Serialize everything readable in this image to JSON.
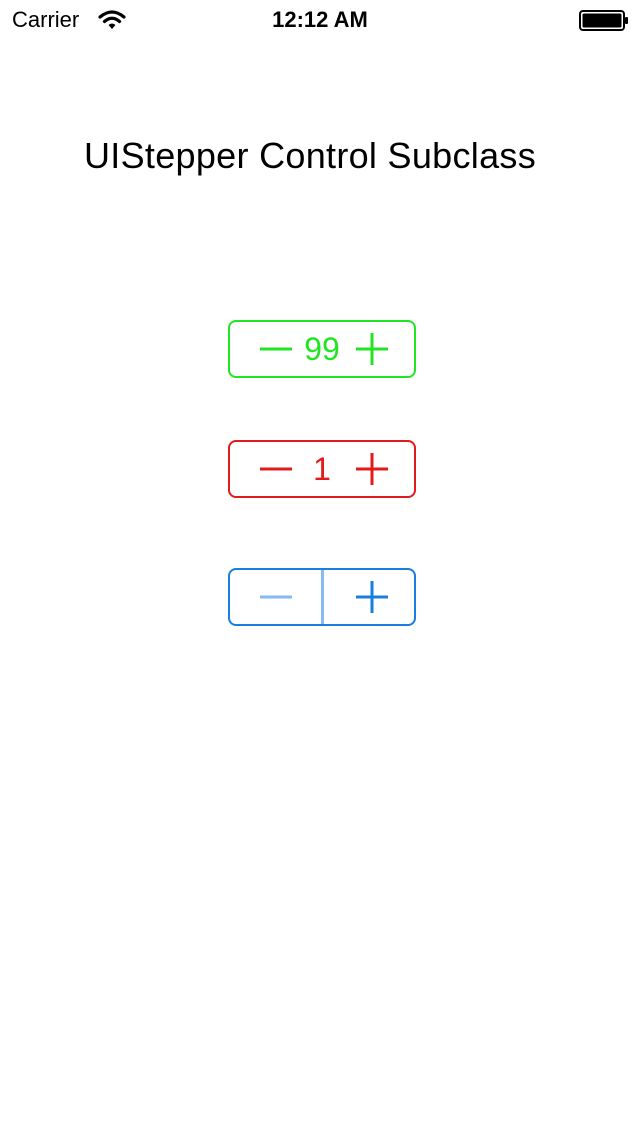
{
  "status_bar": {
    "carrier": "Carrier",
    "time": "12:12 AM",
    "wifi_icon": "wifi-icon",
    "battery_icon": "battery-icon"
  },
  "page": {
    "title": "UIStepper Control Subclass"
  },
  "steppers": [
    {
      "name": "green-stepper",
      "color": "#22e522",
      "value": "99",
      "minus_icon": "minus-icon",
      "plus_icon": "plus-icon"
    },
    {
      "name": "red-stepper",
      "color": "#e21a1a",
      "value": "1",
      "minus_icon": "minus-icon",
      "plus_icon": "plus-icon"
    },
    {
      "name": "blue-stepper",
      "color": "#1a7de0",
      "disabled_color": "#86baf0",
      "minus_enabled": false,
      "minus_icon": "minus-icon",
      "plus_icon": "plus-icon"
    }
  ]
}
